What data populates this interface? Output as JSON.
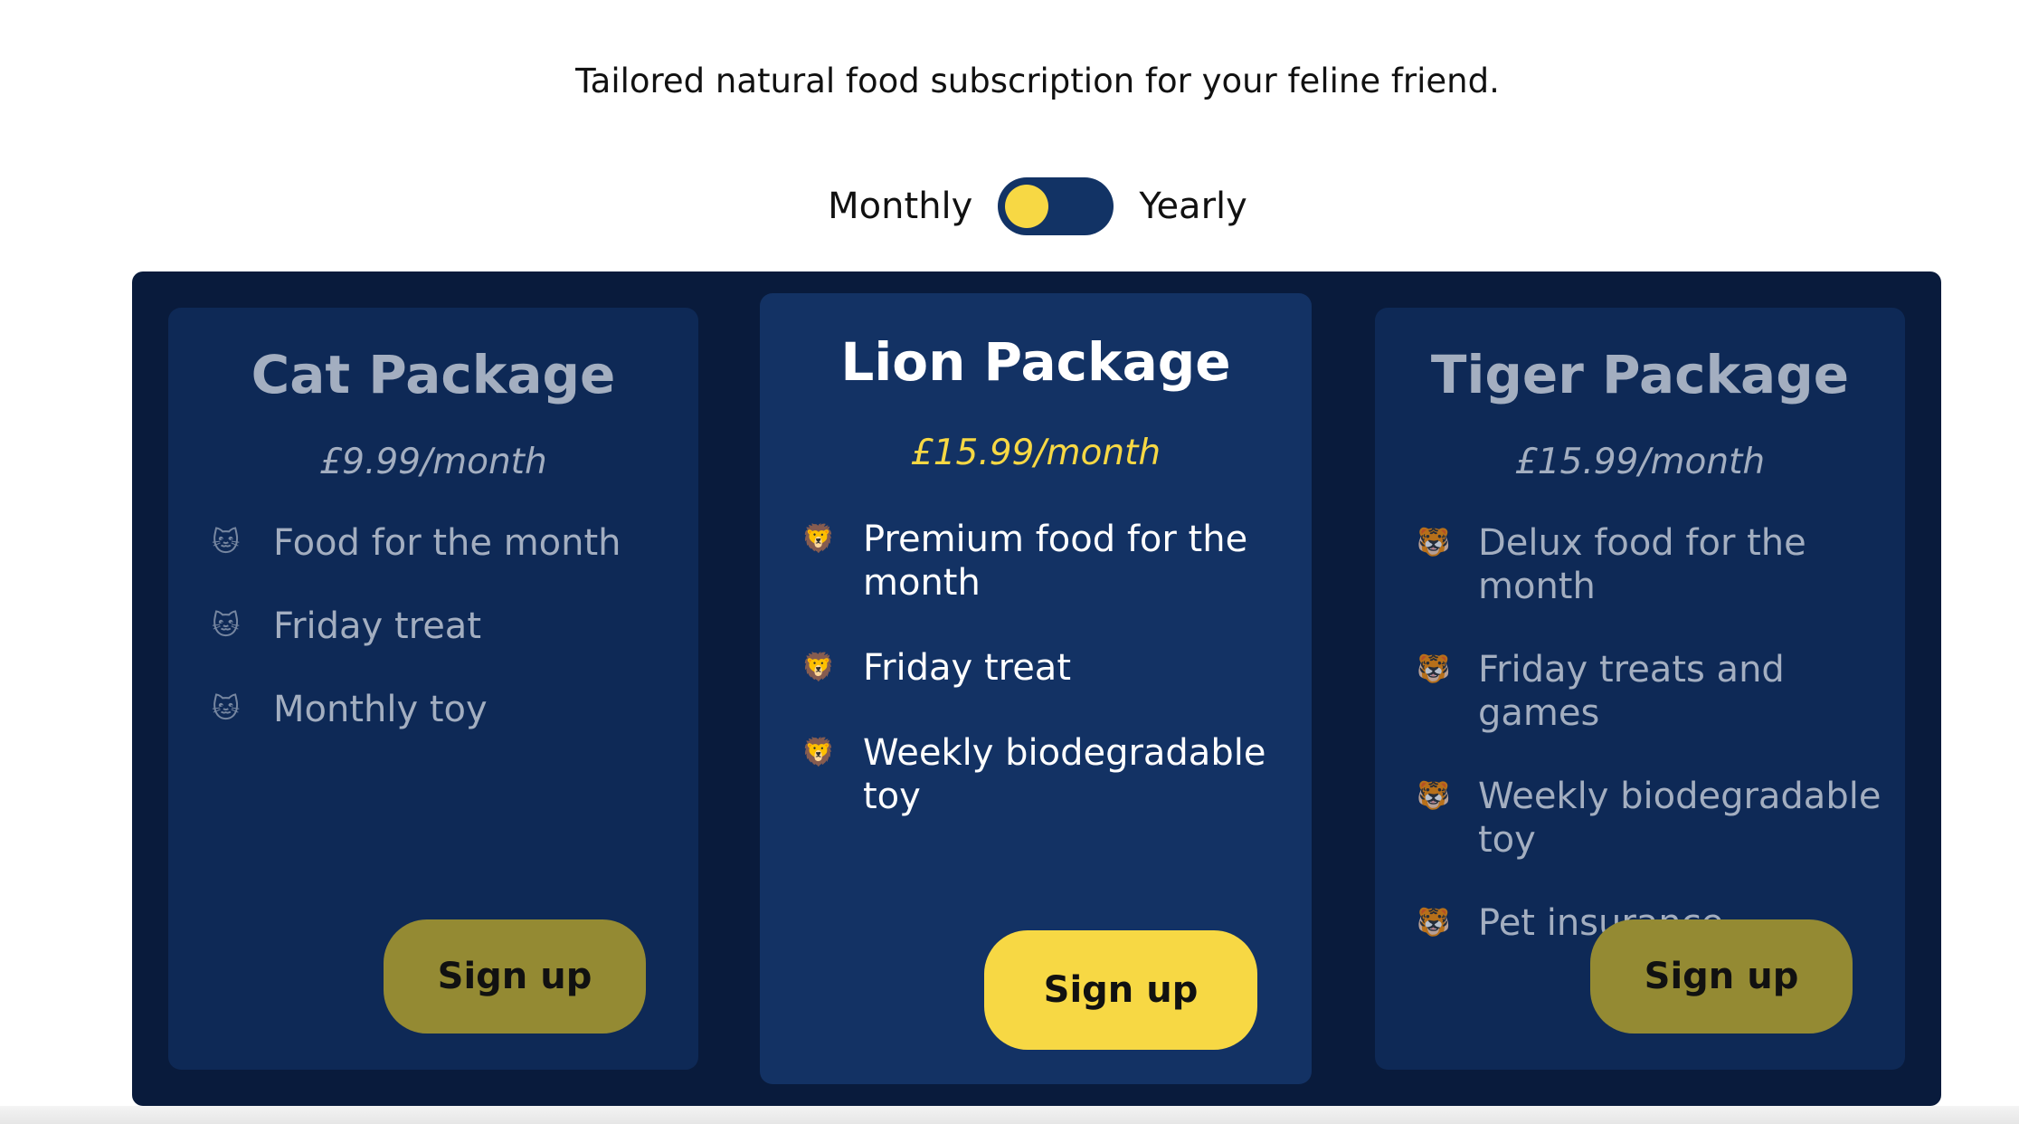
{
  "header": {
    "tagline": "Tailored natural food subscription for your feline friend."
  },
  "billing_toggle": {
    "left_label": "Monthly",
    "right_label": "Yearly",
    "selected": "Monthly"
  },
  "colors": {
    "panel_background": "#091b3c",
    "card_background": "#0e2956",
    "featured_card_background": "#133264",
    "accent_yellow": "#f7d844",
    "muted_button": "#948a33"
  },
  "packages": [
    {
      "title": "Cat Package",
      "price": "£9.99/month",
      "icon": "cat-face-icon",
      "features": [
        "Food for the month",
        "Friday treat",
        "Monthly toy"
      ],
      "button_label": "Sign up",
      "featured": false
    },
    {
      "title": "Lion Package",
      "price": "£15.99/month",
      "icon": "lion-face-icon",
      "features": [
        "Premium food for the month",
        "Friday treat",
        "Weekly biodegradable toy"
      ],
      "button_label": "Sign up",
      "featured": true
    },
    {
      "title": "Tiger Package",
      "price": "£15.99/month",
      "icon": "tiger-face-icon",
      "features": [
        "Delux food for the month",
        "Friday treats and games",
        "Weekly biodegradable toy",
        "Pet insurance"
      ],
      "button_label": "Sign up",
      "featured": false
    }
  ]
}
